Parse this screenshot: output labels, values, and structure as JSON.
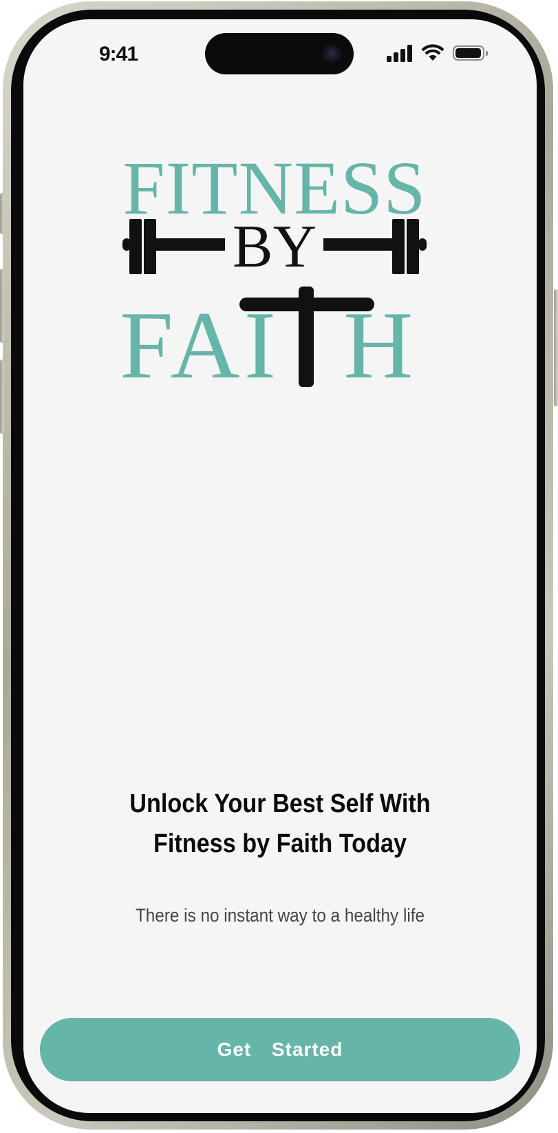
{
  "status_bar": {
    "time": "9:41",
    "icons": [
      "cellular-signal-icon",
      "wifi-icon",
      "battery-icon"
    ]
  },
  "logo": {
    "line1": "FITNESS",
    "line2": "BY",
    "line3_part1": "FAI",
    "line3_part2": "H",
    "icons": [
      "dumbbell-icon",
      "cross-icon"
    ]
  },
  "onboarding": {
    "headline": "Unlock Your Best Self With Fitness by Faith Today",
    "subtitle": "There is no instant way to a healthy life"
  },
  "cta": {
    "label": "Get  Started"
  },
  "colors": {
    "brand": "#66b5a9",
    "screen_background": "#f5f5f5",
    "text_primary": "#0b0b0b",
    "text_secondary": "#444444"
  }
}
